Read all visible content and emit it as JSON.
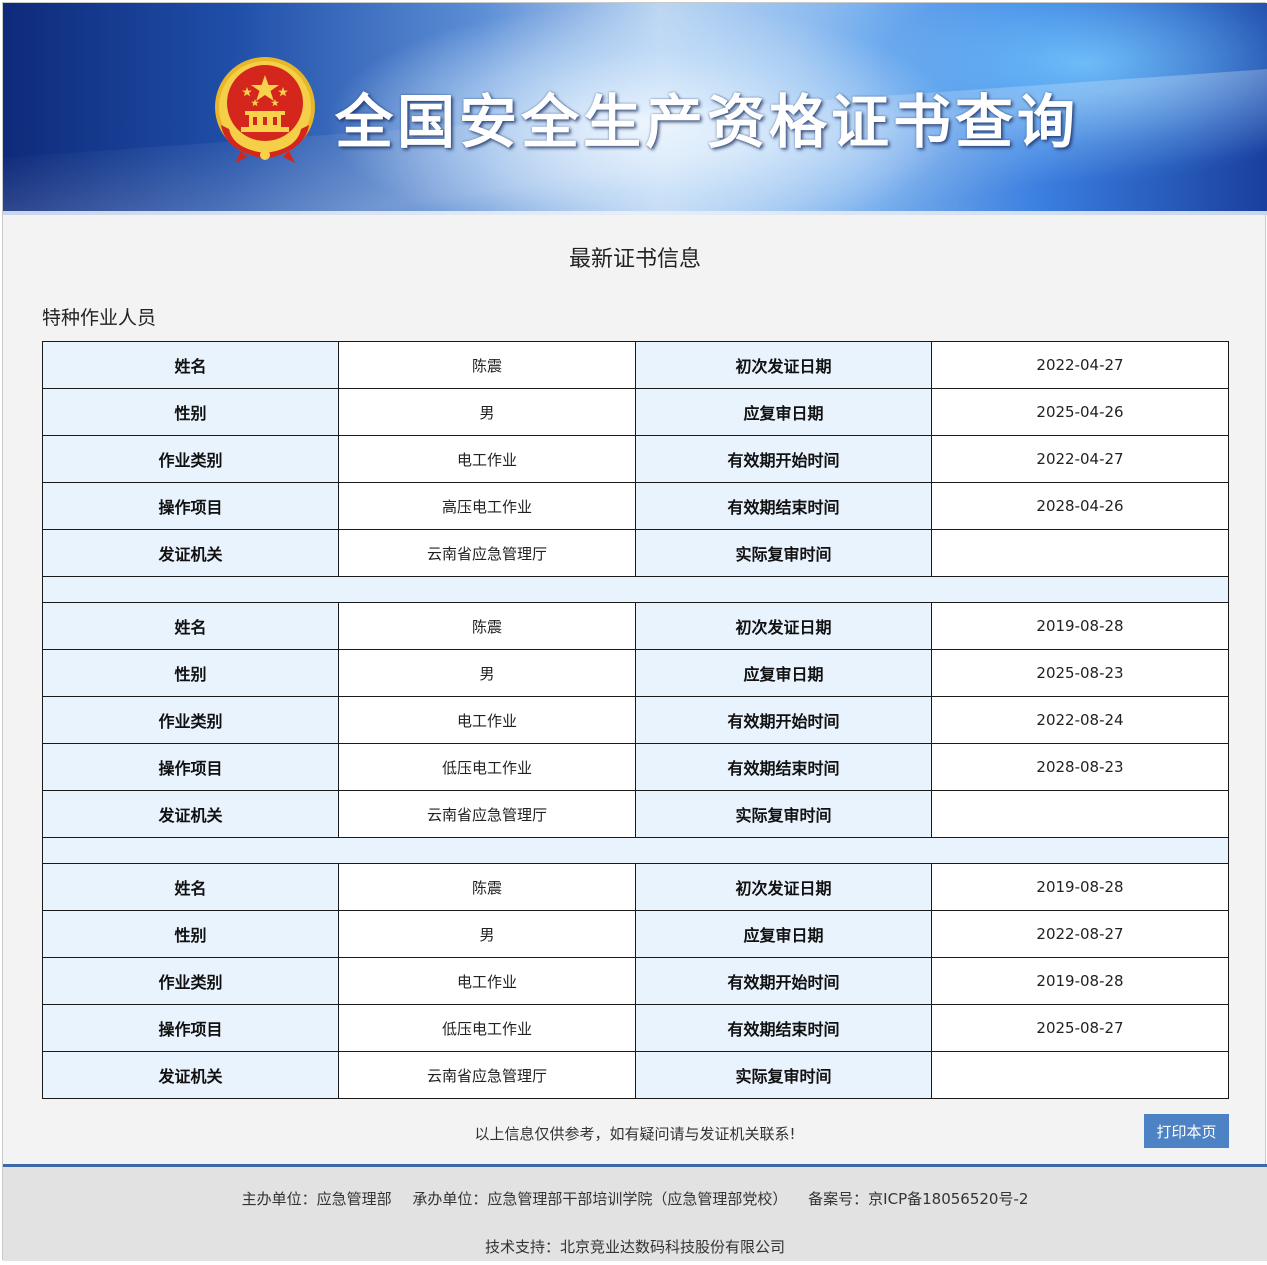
{
  "header": {
    "title": "全国安全生产资格证书查询",
    "emblem_icon": "national-emblem-icon"
  },
  "section_title": "最新证书信息",
  "category": "特种作业人员",
  "labels": {
    "name": "姓名",
    "gender": "性别",
    "work_category": "作业类别",
    "operation_item": "操作项目",
    "issuer": "发证机关",
    "first_issue_date": "初次发证日期",
    "review_due_date": "应复审日期",
    "valid_start": "有效期开始时间",
    "valid_end": "有效期结束时间",
    "actual_review": "实际复审时间"
  },
  "certificates": [
    {
      "name": "陈震",
      "gender": "男",
      "work_category": "电工作业",
      "operation_item": "高压电工作业",
      "issuer": "云南省应急管理厅",
      "first_issue_date": "2022-04-27",
      "review_due_date": "2025-04-26",
      "valid_start": "2022-04-27",
      "valid_end": "2028-04-26",
      "actual_review": ""
    },
    {
      "name": "陈震",
      "gender": "男",
      "work_category": "电工作业",
      "operation_item": "低压电工作业",
      "issuer": "云南省应急管理厅",
      "first_issue_date": "2019-08-28",
      "review_due_date": "2025-08-23",
      "valid_start": "2022-08-24",
      "valid_end": "2028-08-23",
      "actual_review": ""
    },
    {
      "name": "陈震",
      "gender": "男",
      "work_category": "电工作业",
      "operation_item": "低压电工作业",
      "issuer": "云南省应急管理厅",
      "first_issue_date": "2019-08-28",
      "review_due_date": "2022-08-27",
      "valid_start": "2019-08-28",
      "valid_end": "2025-08-27",
      "actual_review": ""
    }
  ],
  "disclaimer": "以上信息仅供参考，如有疑问请与发证机关联系!",
  "print_button": "打印本页",
  "footer": {
    "host": "主办单位：应急管理部",
    "organizer": "承办单位：应急管理部干部培训学院（应急管理部党校）",
    "icp": "备案号：京ICP备18056520号-2",
    "support": "技术支持：北京竞业达数码科技股份有限公司"
  },
  "colors": {
    "label_cell_bg": "#e9f3fd",
    "print_button_bg": "#4d82c4",
    "footer_bg": "#e2e2e2",
    "footer_border": "#3c6aa8",
    "emblem_red": "#d4261c",
    "emblem_gold": "#f2c230"
  }
}
